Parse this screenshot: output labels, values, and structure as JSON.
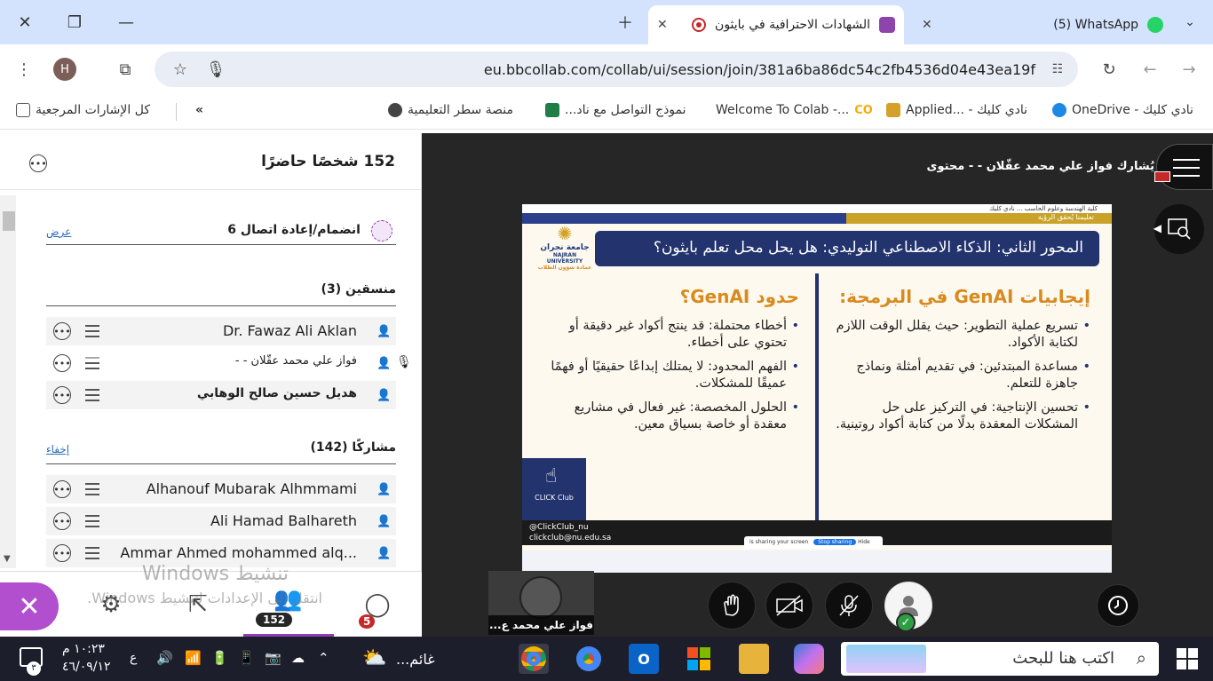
{
  "browser": {
    "tabs": [
      {
        "title": "الشهادات الاحترافية في بايثون",
        "active": true
      },
      {
        "title": "(5) WhatsApp",
        "active": false
      }
    ],
    "profile_initial": "H",
    "url": "eu.bbcollab.com/collab/ui/session/join/381a6ba86dc54c2fb4536d04e43ea19f",
    "bookmarks": [
      "نادي كليك - OneDrive",
      "نادي كليك - ...Applied",
      "Welcome To Colab -...",
      "نموذج التواصل مع ناد...",
      "منصة سطر التعليمية"
    ],
    "all_bookmarks": "كل الإشارات المرجعية"
  },
  "panel": {
    "title": "152 شخصًا حاضرًا",
    "join_label": "انضمام/إعادة اتصال 6",
    "join_link": "عرض",
    "coordinators_title": "منسقين (3)",
    "coordinators": [
      {
        "name": "Dr. Fawaz Ali Aklan",
        "bold": false
      },
      {
        "name": "فواز علي محمد عقّلان - -",
        "bold": false
      },
      {
        "name": "هديل حسين صالح الوهابي",
        "bold": true
      }
    ],
    "participants_title": "مشاركًا (142)",
    "participants_link": "إخفاء",
    "participants": [
      {
        "name": "Alhanouf Mubarak Alhmmami"
      },
      {
        "name": "Ali Hamad Balhareth"
      },
      {
        "name": "Ammar Ahmed mohammed alq..."
      }
    ]
  },
  "panel_bar": {
    "attendees_count": "152",
    "chat_count": "5"
  },
  "watermark": {
    "line1": "تنشيط Windows",
    "line2": "انتقل إلى الإعدادات لتنشيط Windows."
  },
  "stage": {
    "sharing_text": "يُشارك فواز علي محمد عقّلان - - محتوى",
    "video_name": "فواز علي محمد ع..."
  },
  "slide": {
    "top_strip": "كلية الهندسة وعلوم الحاسب ... نادي كليك",
    "band_text": "تعليمنا يُحقق الرؤية",
    "title": "المحور الثاني: الذكاء الاصطناعي التوليدي: هل يحل محل تعلم بايثون؟",
    "logo_text": "جامعة نجران",
    "logo_en": "NAJRAN UNIVERSITY",
    "logo_sub": "عمادة شؤون الطلاب",
    "right_head": "إيجابيات GenAI في البرمجة:",
    "right_bullets": [
      "تسريع عملية التطوير: حيث يقلل الوقت اللازم لكتابة الأكواد.",
      "مساعدة المبتدئين: في تقديم أمثلة ونماذج جاهزة للتعلم.",
      "تحسين الإنتاجية: في التركيز على حل المشكلات المعقدة بدلًا من كتابة أكواد روتينية."
    ],
    "left_head": "حدود GenAI؟",
    "left_bullets": [
      "أخطاء محتملة: قد ينتج أكواد غير دقيقة أو تحتوي على أخطاء.",
      "الفهم المحدود: لا يمتلك إبداعًا حقيقيًا أو فهمًا عميقًا للمشكلات.",
      "الحلول المخصصة: غير فعال في مشاريع معقدة أو خاصة بسياق معين."
    ],
    "club_name": "CLICK Club",
    "club_handle": "@ClickClub_nu",
    "club_email": "clickclub@nu.edu.sa",
    "sharing_msg": "is sharing your screen",
    "stop_sharing": "Stop sharing",
    "hide": "Hide"
  },
  "taskbar": {
    "search_placeholder": "اكتب هنا للبحث",
    "weather": "غائم...",
    "time": "١٠:٢٣ م",
    "date": "٤٦/٠٩/١٢",
    "lang": "ع",
    "notif_count": "٣"
  },
  "colors": {
    "tab_bar": "#d3e3fd",
    "accent_purple": "#b24fcf",
    "stage_bg": "#262626",
    "slide_navy": "#22336e",
    "slide_orange": "#d88a1e",
    "taskbar": "#1c1f2b"
  }
}
